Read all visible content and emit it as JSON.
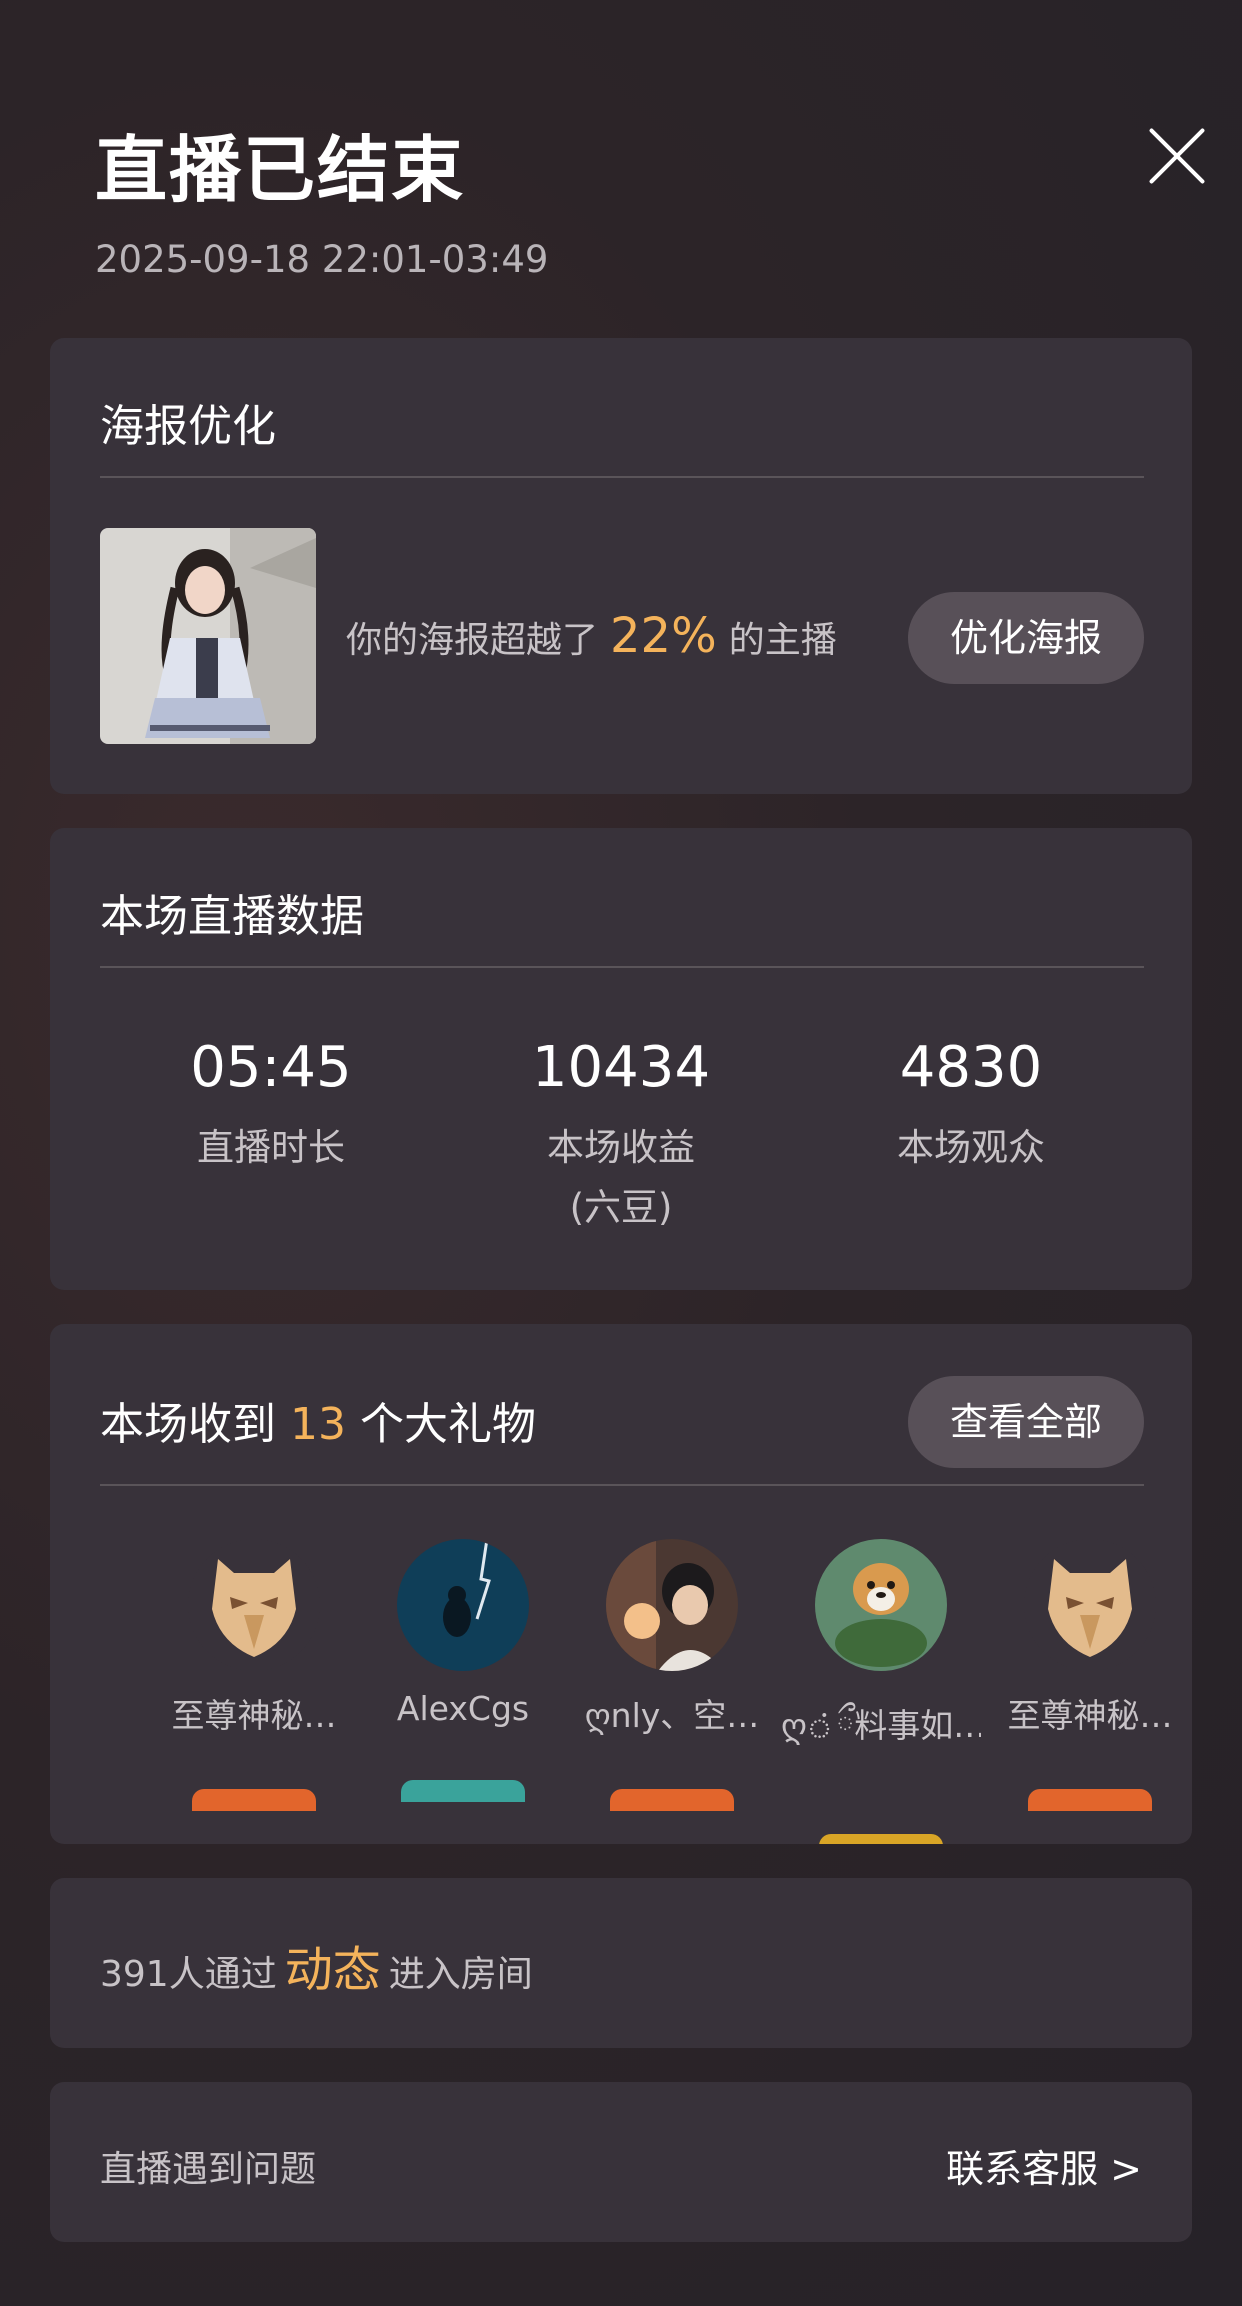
{
  "header": {
    "title": "直播已结束",
    "time_range": "2025-09-18 22:01-03:49"
  },
  "poster": {
    "title": "海报优化",
    "desc_prefix": "你的海报超越了",
    "percent": "22%",
    "desc_suffix": "的主播",
    "button": "优化海报"
  },
  "stats": {
    "title": "本场直播数据",
    "items": [
      {
        "value": "05:45",
        "label": "直播时长",
        "sub": ""
      },
      {
        "value": "10434",
        "label": "本场收益",
        "sub": "(六豆)"
      },
      {
        "value": "4830",
        "label": "本场观众",
        "sub": ""
      }
    ]
  },
  "gifts": {
    "title_prefix": "本场收到",
    "count": "13",
    "title_suffix": "个大礼物",
    "button": "查看全部",
    "senders": [
      {
        "name": "至尊神秘…",
        "avatar": "gold-mask",
        "badge_color": "#e2652c"
      },
      {
        "name": "AlexCgs",
        "avatar": "night-sea",
        "badge_color": "#3aa39b"
      },
      {
        "name": "ღnly、空…",
        "avatar": "boy-portrait",
        "badge_color": "#e2652c"
      },
      {
        "name": "ღ்ྀ料事如…",
        "avatar": "dog-turtle",
        "badge_color": "#d9a526"
      },
      {
        "name": "至尊神秘…",
        "avatar": "gold-mask",
        "badge_color": "#e2652c"
      }
    ]
  },
  "dynamic": {
    "prefix": "391人通过",
    "highlight": "动态",
    "suffix": "进入房间"
  },
  "support": {
    "label": "直播遇到问题",
    "link": "联系客服 >"
  },
  "colors": {
    "accent": "#f4b35b",
    "card": "#38323a",
    "pill": "#585058"
  }
}
